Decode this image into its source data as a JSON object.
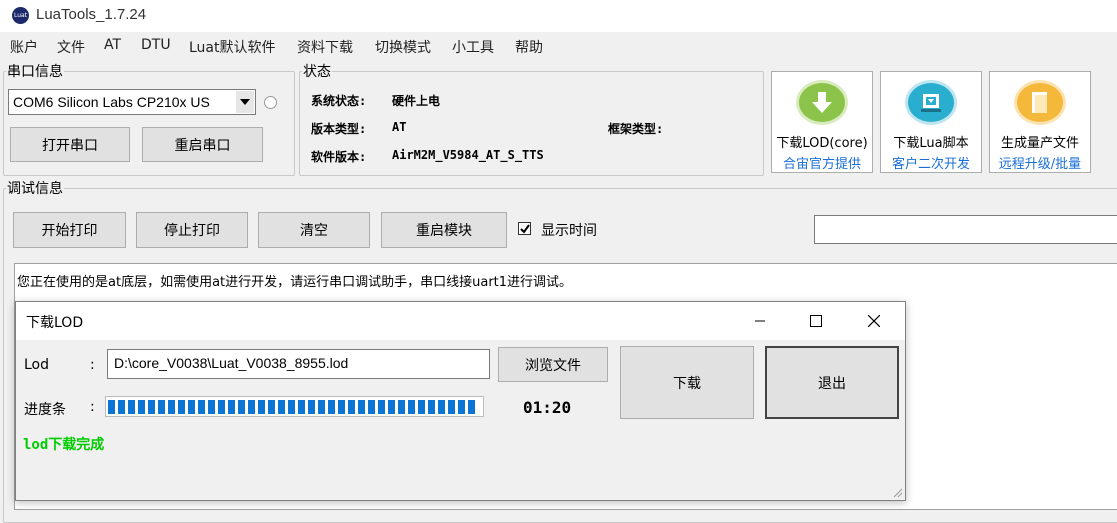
{
  "window": {
    "title": "LuaTools_1.7.24",
    "icon_text": "Luat"
  },
  "menu": [
    "账户",
    "文件",
    "AT",
    "DTU",
    "Luat默认软件",
    "资料下载",
    "切换模式",
    "小工具",
    "帮助"
  ],
  "serial": {
    "group_label": "串口信息",
    "port_value": "COM6 Silicon Labs CP210x US",
    "open_label": "打开串口",
    "restart_label": "重启串口"
  },
  "status": {
    "group_label": "状态",
    "sys_label": "系统状态:",
    "sys_value": "硬件上电",
    "ver_type_label": "版本类型:",
    "ver_type_value": "AT",
    "frame_label": "框架类型:",
    "sw_label": "软件版本:",
    "sw_value": "AirM2M_V5984_AT_S_TTS"
  },
  "tools": [
    {
      "line1": "下载LOD(core)",
      "line2": "合宙官方提供",
      "icon": "download-arrow-icon",
      "color": "#8cc34a"
    },
    {
      "line1": "下载Lua脚本",
      "line2": "客户二次开发",
      "icon": "script-download-icon",
      "color": "#2aaed0"
    },
    {
      "line1": "生成量产文件",
      "line2": "远程升级/批量",
      "icon": "document-icon",
      "color": "#f4b93a"
    }
  ],
  "debug": {
    "group_label": "调试信息",
    "start_print": "开始打印",
    "stop_print": "停止打印",
    "clear": "清空",
    "restart_module": "重启模块",
    "show_time_label": "显示时间",
    "show_time_checked": true,
    "log_line": "您正在使用的是at底层，如需使用at进行开发，请运行串口调试助手，串口线接uart1进行调试。"
  },
  "dialog": {
    "title": "下载LOD",
    "lod_label": "Lod",
    "colon": ":",
    "lod_path": "D:\\core_V0038\\Luat_V0038_8955.lod",
    "browse_label": "浏览文件",
    "download_label": "下载",
    "exit_label": "退出",
    "progress_label": "进度条",
    "progress_fraction": 1.0,
    "elapsed": "01:20",
    "status_text": "lod下载完成",
    "status_color": "#00cc00"
  }
}
